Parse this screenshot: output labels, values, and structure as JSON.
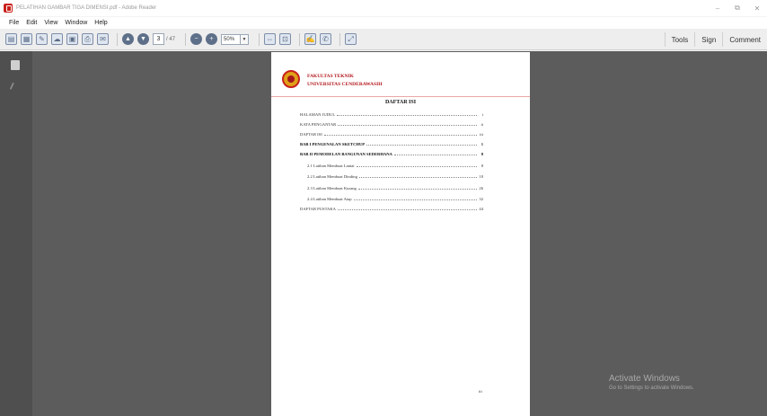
{
  "window": {
    "title": "PELATIHAN GAMBAR TIGA DIMENSI.pdf - Adobe Reader",
    "controls": [
      "–",
      "⧉",
      "✕"
    ]
  },
  "menu": [
    "File",
    "Edit",
    "View",
    "Window",
    "Help"
  ],
  "toolbar": {
    "current_page": "3",
    "page_count": "/ 47",
    "zoom": "50%",
    "right_links": [
      "Tools",
      "Sign",
      "Comment"
    ]
  },
  "document": {
    "faculty": "FAKULTAS TEKNIK",
    "university": "UNIVERSITAS CENDERAWASIH",
    "toc_title": "DAFTAR ISI",
    "toc": [
      {
        "label": "HALAMAN JUDUL",
        "page": "i",
        "level": 0,
        "bold": false
      },
      {
        "label": "KATA PENGANTAR",
        "page": "ii",
        "level": 0,
        "bold": false
      },
      {
        "label": "DAFTAR ISI",
        "page": "iii",
        "level": 0,
        "bold": false
      },
      {
        "label": "BAB I PENGENALAN SKETCHUP",
        "page": "1",
        "level": 0,
        "bold": true
      },
      {
        "label": "BAB II PEMODELAN BANGUNAN SEDERHANA",
        "page": "8",
        "level": 0,
        "bold": true
      },
      {
        "label": "2.1 Latihan Membuat Lantai",
        "page": "8",
        "level": 1,
        "bold": false
      },
      {
        "label": "2.2 Latihan Membuat Dinding",
        "page": "10",
        "level": 1,
        "bold": false
      },
      {
        "label": "2.3 Latihan Membuat Kusang",
        "page": "26",
        "level": 1,
        "bold": false
      },
      {
        "label": "2.4 Latihan Membuat Atap",
        "page": "32",
        "level": 1,
        "bold": false
      },
      {
        "label": "DAFTAR PUSTAKA",
        "page": "44",
        "level": 0,
        "bold": false
      }
    ],
    "footer_page": "iii"
  },
  "watermark": {
    "title": "Activate Windows",
    "subtitle": "Go to Settings to activate Windows."
  },
  "colors": {
    "doc_bg": "#5c5c5c",
    "nav_bg": "#4f4f4f",
    "header_red": "#b3161b",
    "toolbar_bg": "#eeeeee"
  }
}
